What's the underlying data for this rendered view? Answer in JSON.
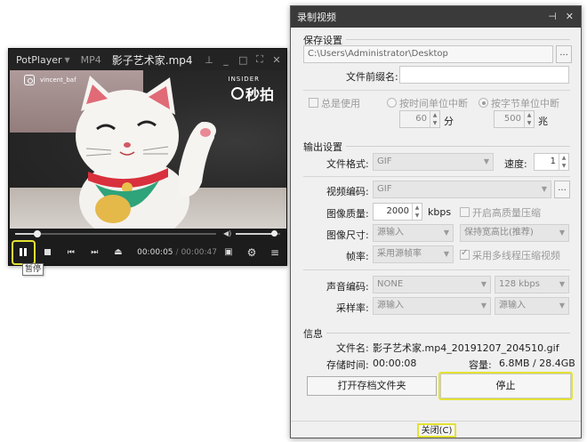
{
  "player": {
    "app_name": "PotPlayer",
    "format": "MP4",
    "filename": "影子艺术家.mp4",
    "watermark_user": "vincent_baf",
    "watermark_insider": "INSIDER",
    "watermark_logo": "秒拍",
    "progress": 0.11,
    "volume": 0.85,
    "time_current": "00:00:05",
    "time_separator": "/",
    "time_total": "00:00:47",
    "tooltip": "暂停",
    "colors": {
      "highlight": "#e4e233",
      "background": "#1c1c1c"
    }
  },
  "recorder": {
    "title": "录制视频",
    "save_section": {
      "label": "保存设置",
      "path": "C:\\Users\\Administrator\\Desktop",
      "browse_label": "...",
      "prefix_label": "文件前缀名:",
      "prefix_value": "",
      "always_use_label": "总是使用",
      "by_time_label": "按时间单位中断",
      "by_size_label": "按字节单位中断",
      "time_value": "60",
      "time_unit": "分",
      "size_value": "500",
      "size_unit": "兆"
    },
    "output_section": {
      "label": "输出设置",
      "format_label": "文件格式:",
      "format_value": "GIF",
      "speed_label": "速度:",
      "speed_value": "1",
      "video_codec_label": "视频编码:",
      "video_codec_value": "GIF",
      "codec_browse_label": "...",
      "quality_label": "图像质量:",
      "quality_value": "2000",
      "quality_unit": "kbps",
      "hq_label": "开启高质量压缩",
      "size_label": "图像尺寸:",
      "size_value": "源输入",
      "aspect_value": "保持宽高比(推荐)",
      "fps_label": "帧率:",
      "fps_value": "采用源帧率",
      "multithread_label": "采用多线程压缩视频",
      "audio_codec_label": "声音编码:",
      "audio_codec_value": "NONE",
      "audio_bitrate_value": "128 kbps",
      "samplerate_label": "采样率:",
      "samplerate_value": "源输入",
      "channels_value": "源输入"
    },
    "info_section": {
      "label": "信息",
      "filename_label": "文件名:",
      "filename_value": "影子艺术家.mp4_20191207_204510.gif",
      "duration_label": "存储时间:",
      "duration_value": "00:00:08",
      "capacity_label": "容量:",
      "capacity_value": "6.8MB / 28.4GB"
    },
    "open_folder_label": "打开存档文件夹",
    "stop_label": "停止",
    "close_label": "关闭(C)",
    "colors": {
      "highlight": "#e4e233",
      "titlebar": "#3a3a3a",
      "dialog_bg": "#f0f0f0"
    }
  }
}
